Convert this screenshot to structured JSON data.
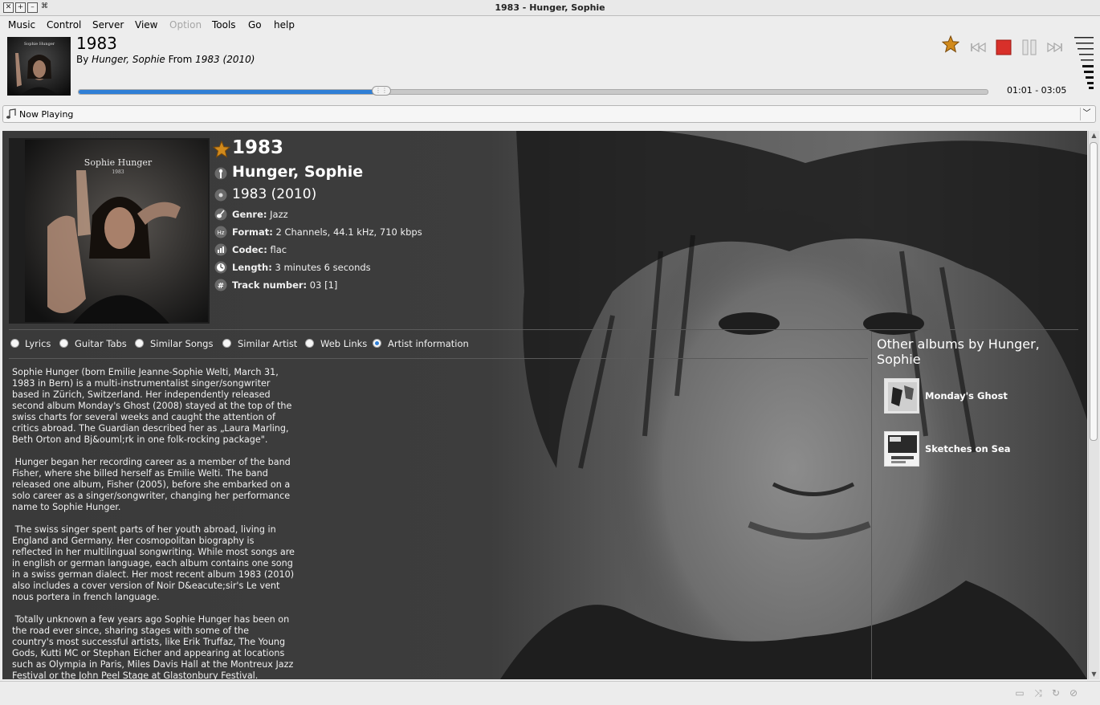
{
  "window": {
    "title": "1983 - Hunger, Sophie"
  },
  "menubar": {
    "items": [
      {
        "label": "Music",
        "accel": "M"
      },
      {
        "label": "Control",
        "accel": "C"
      },
      {
        "label": "Server",
        "accel": "S"
      },
      {
        "label": "View",
        "accel": "V"
      },
      {
        "label": "Option",
        "accel": "O",
        "disabled": true
      },
      {
        "label": "Tools",
        "accel": "T"
      },
      {
        "label": "Go",
        "accel": "G"
      },
      {
        "label": "help",
        "accel": "h"
      }
    ]
  },
  "player": {
    "title": "1983",
    "by_label": "By",
    "artist": "Hunger, Sophie",
    "from_label": "From",
    "album": "1983 (2010)",
    "progress_fraction": 0.333,
    "time_text": "01:01 - 03:05",
    "controls": [
      "star-icon",
      "previous-icon",
      "stop-icon",
      "pause-icon",
      "next-icon"
    ],
    "accent_color": "#2f7fd6",
    "stop_color": "#d8302a"
  },
  "page_selector": {
    "label": "Now Playing"
  },
  "now_playing": {
    "title": "1983",
    "artist": "Hunger, Sophie",
    "album": "1983 (2010)",
    "cover_caption": "Sophie Hunger",
    "cover_subcaption": "1983",
    "details": [
      {
        "label": "Genre:",
        "value": "Jazz",
        "icon": "guitar-icon"
      },
      {
        "label": "Format:",
        "value": "2 Channels, 44.1 kHz, 710 kbps",
        "icon": "hz-icon"
      },
      {
        "label": "Codec:",
        "value": "flac",
        "icon": "codec-icon"
      },
      {
        "label": "Length:",
        "value": "3 minutes 6 seconds",
        "icon": "clock-icon"
      },
      {
        "label": "Track number:",
        "value": "03 [1]",
        "icon": "hash-icon"
      }
    ],
    "tabs": [
      {
        "label": "Lyrics",
        "selected": false
      },
      {
        "label": "Guitar Tabs",
        "selected": false
      },
      {
        "label": "Similar Songs",
        "selected": false
      },
      {
        "label": "Similar Artist",
        "selected": false
      },
      {
        "label": "Web Links",
        "selected": false
      },
      {
        "label": "Artist information",
        "selected": true
      }
    ],
    "bio": "Sophie Hunger (born Emilie Jeanne-Sophie Welti, March 31,\n1983 in Bern) is a multi-instrumentalist singer/songwriter\nbased in Zürich, Switzerland. Her independently released\nsecond album Monday's Ghost (2008) stayed at the top of the\nswiss charts for several weeks and caught the attention of\ncritics abroad. The Guardian described her as „Laura Marling,\nBeth Orton and Bj&ouml;rk in one folk-rocking package\".\n\n Hunger began her recording career as a member of the band\nFisher, where she billed herself as Emilie Welti. The band\nreleased one album, Fisher (2005), before she embarked on a\nsolo career as a singer/songwriter, changing her performance\nname to Sophie Hunger.\n\n The swiss singer spent parts of her youth abroad, living in\nEngland and Germany. Her cosmopolitan biography is\nreflected in her multilingual songwriting. While most songs are\nin english or german language, each album contains one song\nin a swiss german dialect. Her most recent album 1983 (2010)\nalso includes a cover version of Noir D&eacute;sir's Le vent\nnous portera in french language.\n\n Totally unknown a few years ago Sophie Hunger has been on\nthe road ever since, sharing stages with some of the\ncountry's most successful artists, like Erik Truffaz, The Young\nGods, Kutti MC or Stephan Eicher and appearing at locations\nsuch as Olympia in Paris, Miles Davis Hall at the Montreux Jazz\nFestival or the John Peel Stage at Glastonbury Festival.",
    "other_albums": {
      "title": "Other albums by Hunger, Sophie",
      "items": [
        {
          "name": "Monday's Ghost"
        },
        {
          "name": "Sketches on Sea"
        }
      ]
    }
  },
  "statusbar": {
    "icons": [
      "repeat-icon",
      "shuffle-icon",
      "single-icon",
      "consume-icon"
    ]
  }
}
